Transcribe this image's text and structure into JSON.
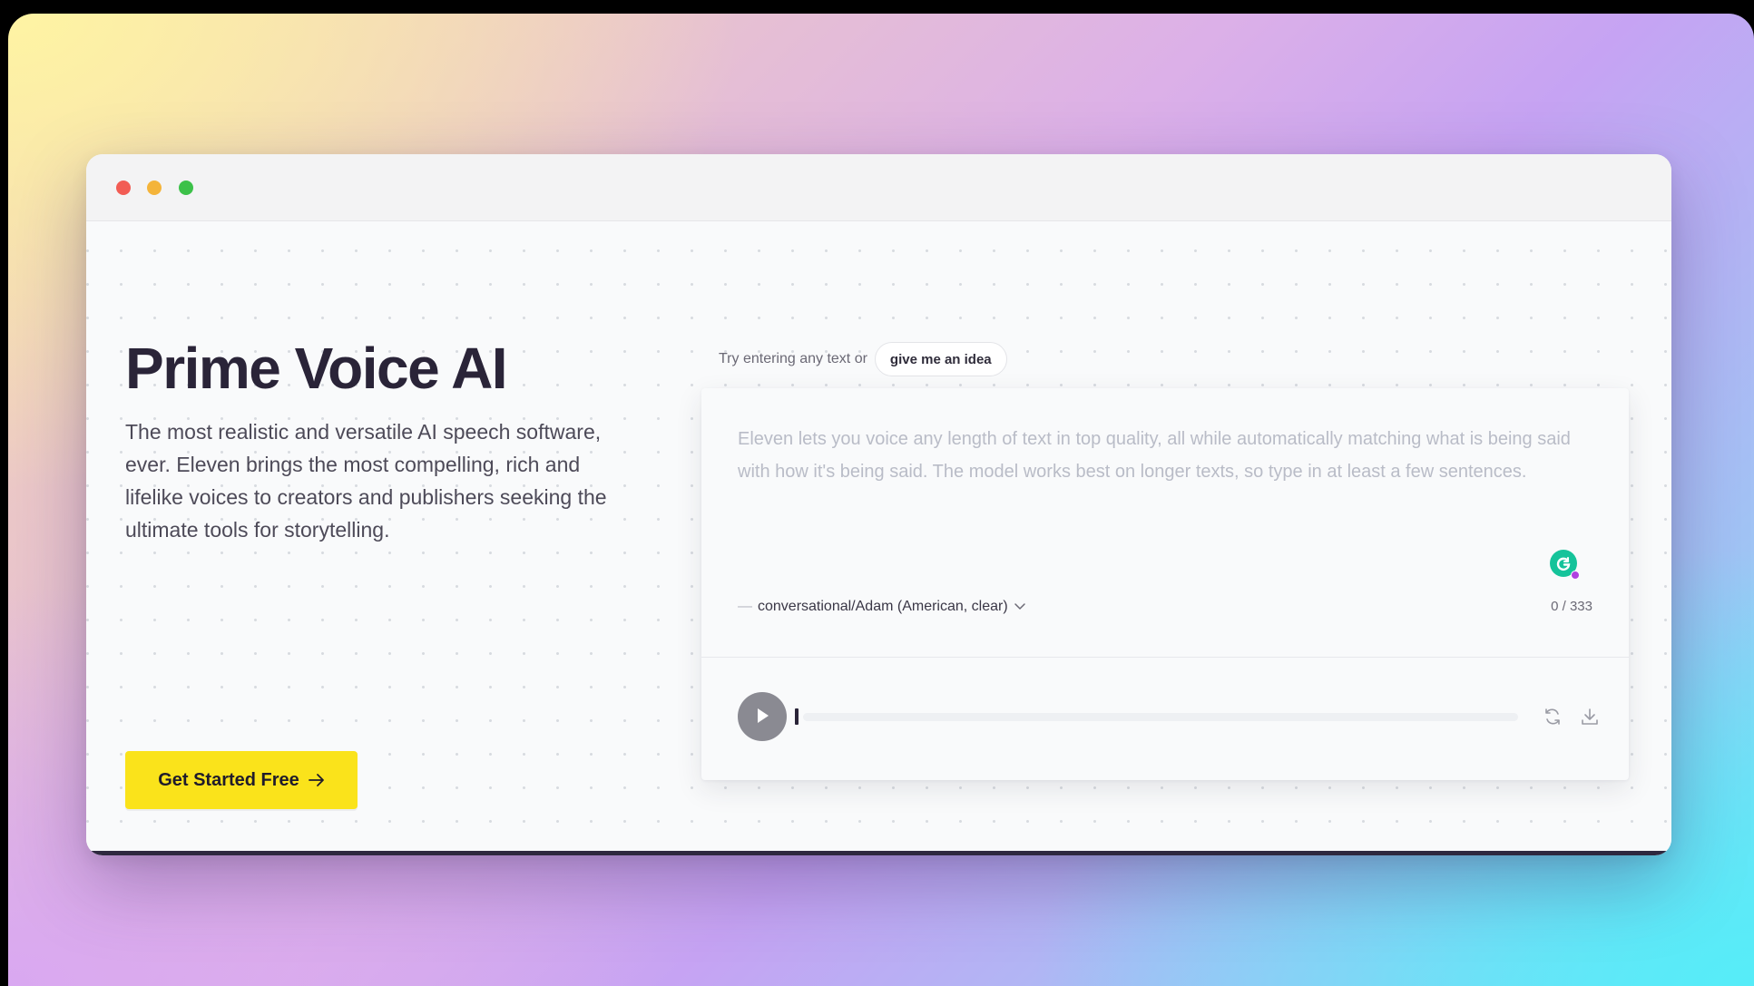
{
  "hero": {
    "title": "Prime Voice AI",
    "description": "The most realistic and versatile AI speech software, ever. Eleven brings the most compelling, rich and lifelike voices to creators and publishers seeking the ultimate tools for storytelling.",
    "cta_label": "Get Started Free"
  },
  "demo": {
    "prompt_text": "Try entering any text or",
    "idea_button": "give me an idea",
    "placeholder": "Eleven lets you voice any length of text in top quality, all while automatically matching what is being said with how it's being said. The model works best on longer texts, so type in at least a few sentences.",
    "voice_dash": "—",
    "voice_label": "conversational/Adam (American, clear)",
    "char_counter": "0 / 333",
    "progress": 0
  },
  "icons": {
    "play": "play-icon",
    "regenerate": "refresh-icon",
    "download": "download-icon",
    "grammarly": "grammarly-icon",
    "arrow": "arrow-right-icon",
    "chevron": "chevron-down-icon"
  },
  "colors": {
    "cta": "#fae31b",
    "dark_band": "#2e283f",
    "grammarly": "#15c39a",
    "traffic_red": "#f25c54",
    "traffic_yellow": "#f4b43a",
    "traffic_green": "#3cc149"
  }
}
